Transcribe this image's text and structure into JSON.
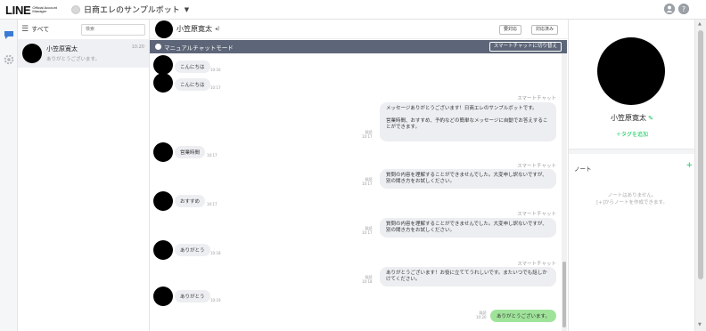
{
  "header": {
    "logo": "LINE",
    "logo_sub": "Official Account Manager",
    "account_name": "日商エレのサンプルボット",
    "caret": "▼"
  },
  "sidebar": {
    "items": [
      {
        "icon": "chat-icon"
      },
      {
        "icon": "gear-icon"
      }
    ]
  },
  "conversation_list": {
    "filter_label": "すべて",
    "search_placeholder": "検索",
    "items": [
      {
        "name": "小笠原寛太",
        "preview": "ありがとうございます。",
        "time": "10:20"
      }
    ]
  },
  "chat": {
    "user_name": "小笠原寛太",
    "done_button": "要対応",
    "in_progress_button": "対応済み",
    "mode_label": "マニュアルチャットモード",
    "switch_button": "スマートチャットに切り替え",
    "messages": [
      {
        "text": "こんにちは",
        "time": "10:16"
      },
      {
        "text": "こんにちは",
        "time": "10:17"
      },
      {
        "label": "スマートチャット",
        "lines": [
          "メッセージありがとうございます！日商エレのサンプルボットです。",
          "営業時間、おすすめ、予約などの簡単なメッセージに自動でお答えすることができます。"
        ],
        "read": "既読",
        "time": "10:17"
      },
      {
        "text": "営業時間",
        "time": "10:17"
      },
      {
        "label": "スマートチャット",
        "lines": [
          "質問の内容を理解することができませんでした。大変申し訳ないですが、別の聞き方をお試しください。"
        ],
        "read": "既読",
        "time": "10:17"
      },
      {
        "text": "おすすめ",
        "time": "10:17"
      },
      {
        "label": "スマートチャット",
        "lines": [
          "質問の内容を理解することができませんでした。大変申し訳ないですが、別の聞き方をお試しください。"
        ],
        "read": "既読",
        "time": "10:17"
      },
      {
        "text": "ありがとう",
        "time": "10:18"
      },
      {
        "label": "スマートチャット",
        "lines": [
          "ありがとうございます！お役に立ててうれしいです。またいつでも話しかけてください。"
        ],
        "read": "既読",
        "time": "10:18"
      },
      {
        "text": "ありがとう",
        "time": "10:19"
      },
      {
        "text": "ありがとうございます。",
        "read": "既読",
        "time": "10:20"
      }
    ]
  },
  "profile": {
    "name": "小笠原寛太",
    "add_tag": "＋タグを追加",
    "note_title": "ノート",
    "note_add": "+",
    "note_empty_1": "ノートはありません。",
    "note_empty_2": "[+]からノートを作成できます。"
  },
  "colors": {
    "accent": "#06c755",
    "mode_bar": "#5d6678",
    "bubble": "#eceef1",
    "sent_bubble": "#9fe39a"
  }
}
